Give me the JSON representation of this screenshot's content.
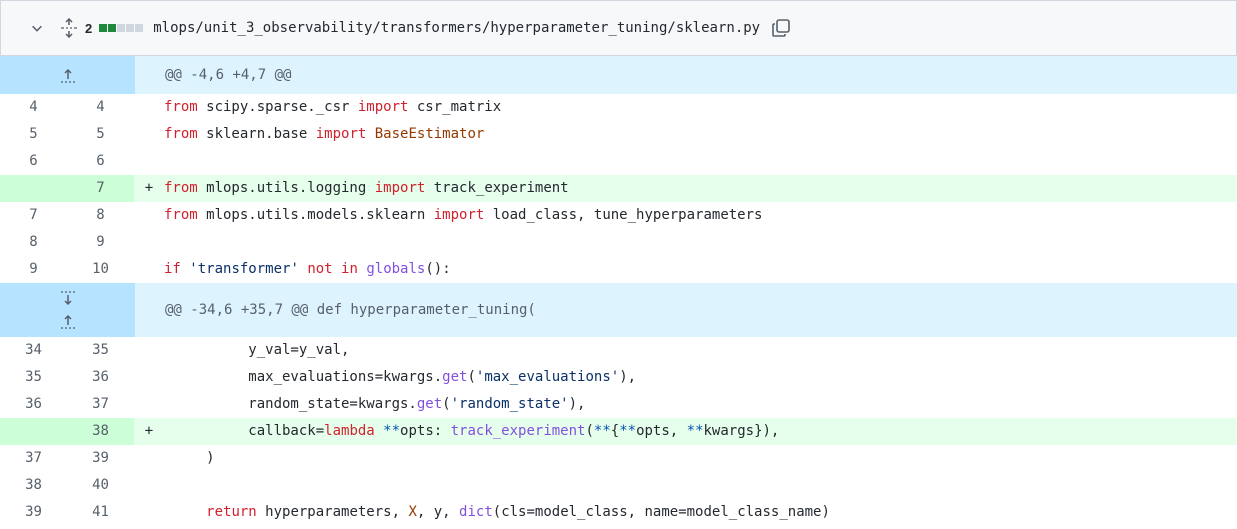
{
  "header": {
    "change_count": "2",
    "file_path": "mlops/unit_3_observability/transformers/hyperparameter_tuning/sklearn.py",
    "diffstat": [
      "add",
      "add",
      "neutral",
      "neutral",
      "neutral"
    ],
    "icons": [
      "chevron-down-icon",
      "unfold-icon",
      "copy-icon"
    ]
  },
  "hunks": [
    {
      "header": "@@ -4,6 +4,7 @@"
    },
    {
      "header": "@@ -34,6 +35,7 @@ def hyperparameter_tuning("
    }
  ],
  "lines": [
    {
      "old": "4",
      "new": "4",
      "marker": "",
      "type": "context",
      "tokens": [
        [
          "k",
          "from"
        ],
        [
          "t",
          " scipy.sparse._csr "
        ],
        [
          "k",
          "import"
        ],
        [
          "t",
          " csr_matrix"
        ]
      ]
    },
    {
      "old": "5",
      "new": "5",
      "marker": "",
      "type": "context",
      "tokens": [
        [
          "k",
          "from"
        ],
        [
          "t",
          " sklearn.base "
        ],
        [
          "k",
          "import"
        ],
        [
          "t",
          " "
        ],
        [
          "c",
          "BaseEstimator"
        ]
      ]
    },
    {
      "old": "6",
      "new": "6",
      "marker": "",
      "type": "context",
      "tokens": []
    },
    {
      "old": "",
      "new": "7",
      "marker": "+",
      "type": "add",
      "tokens": [
        [
          "k",
          "from"
        ],
        [
          "t",
          " mlops.utils.logging "
        ],
        [
          "k",
          "import"
        ],
        [
          "t",
          " track_experiment"
        ]
      ]
    },
    {
      "old": "7",
      "new": "8",
      "marker": "",
      "type": "context",
      "tokens": [
        [
          "k",
          "from"
        ],
        [
          "t",
          " mlops.utils.models.sklearn "
        ],
        [
          "k",
          "import"
        ],
        [
          "t",
          " load_class, tune_hyperparameters"
        ]
      ]
    },
    {
      "old": "8",
      "new": "9",
      "marker": "",
      "type": "context",
      "tokens": []
    },
    {
      "old": "9",
      "new": "10",
      "marker": "",
      "type": "context",
      "tokens": [
        [
          "k",
          "if"
        ],
        [
          "t",
          " "
        ],
        [
          "s",
          "'transformer'"
        ],
        [
          "t",
          " "
        ],
        [
          "k",
          "not"
        ],
        [
          "t",
          " "
        ],
        [
          "k",
          "in"
        ],
        [
          "t",
          " "
        ],
        [
          "f",
          "globals"
        ],
        [
          "t",
          "():"
        ]
      ]
    },
    {
      "old": "34",
      "new": "35",
      "marker": "",
      "type": "context",
      "tokens": [
        [
          "t",
          "          y_val=y_val,"
        ]
      ]
    },
    {
      "old": "35",
      "new": "36",
      "marker": "",
      "type": "context",
      "tokens": [
        [
          "t",
          "          max_evaluations=kwargs."
        ],
        [
          "f",
          "get"
        ],
        [
          "t",
          "("
        ],
        [
          "s",
          "'max_evaluations'"
        ],
        [
          "t",
          "),"
        ]
      ]
    },
    {
      "old": "36",
      "new": "37",
      "marker": "",
      "type": "context",
      "tokens": [
        [
          "t",
          "          random_state=kwargs."
        ],
        [
          "f",
          "get"
        ],
        [
          "t",
          "("
        ],
        [
          "s",
          "'random_state'"
        ],
        [
          "t",
          "),"
        ]
      ]
    },
    {
      "old": "",
      "new": "38",
      "marker": "+",
      "type": "add",
      "tokens": [
        [
          "t",
          "          callback="
        ],
        [
          "k",
          "lambda"
        ],
        [
          "t",
          " "
        ],
        [
          "o",
          "**"
        ],
        [
          "t",
          "opts: "
        ],
        [
          "f",
          "track_experiment"
        ],
        [
          "t",
          "("
        ],
        [
          "o",
          "**"
        ],
        [
          "t",
          "{"
        ],
        [
          "o",
          "**"
        ],
        [
          "t",
          "opts, "
        ],
        [
          "o",
          "**"
        ],
        [
          "t",
          "kwargs}),"
        ]
      ]
    },
    {
      "old": "37",
      "new": "39",
      "marker": "",
      "type": "context",
      "tokens": [
        [
          "t",
          "     )"
        ]
      ]
    },
    {
      "old": "38",
      "new": "40",
      "marker": "",
      "type": "context",
      "tokens": []
    },
    {
      "old": "39",
      "new": "41",
      "marker": "",
      "type": "context",
      "tokens": [
        [
          "t",
          "     "
        ],
        [
          "k",
          "return"
        ],
        [
          "t",
          " hyperparameters, "
        ],
        [
          "c",
          "X"
        ],
        [
          "t",
          ", y, "
        ],
        [
          "f",
          "dict"
        ],
        [
          "t",
          "(cls=model_class, name=model_class_name)"
        ]
      ]
    }
  ]
}
